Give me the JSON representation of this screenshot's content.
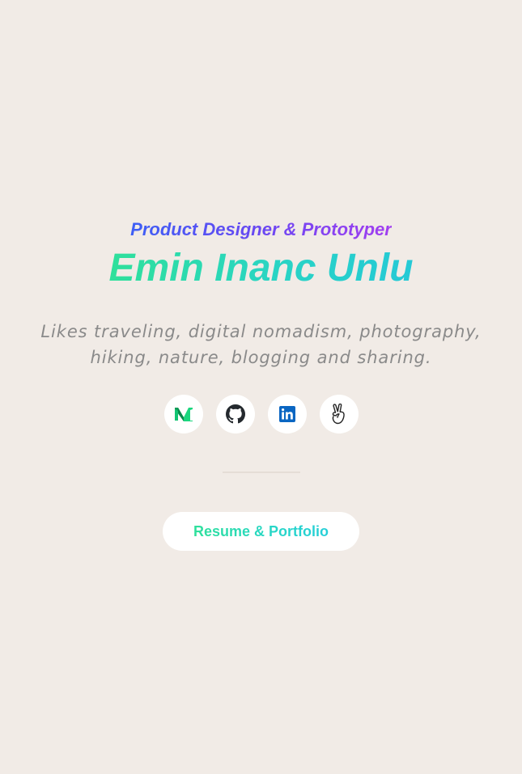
{
  "header": {
    "subtitle": "Product Designer & Prototyper",
    "name": "Emin Inanc Unlu",
    "bio": "Likes traveling, digital nomadism, photography, hiking, nature, blogging and sharing."
  },
  "socials": [
    {
      "icon": "medium-icon"
    },
    {
      "icon": "github-icon"
    },
    {
      "icon": "linkedin-icon"
    },
    {
      "icon": "angellist-icon"
    }
  ],
  "cta": {
    "label": "Resume & Portfolio"
  },
  "colors": {
    "background": "#f1ebe6",
    "subtitle_gradient": [
      "#3d5ff5",
      "#a23ef0"
    ],
    "name_gradient": [
      "#2fe09b",
      "#25c9d6"
    ],
    "bio_text": "#8a8a8a",
    "medium_green": "#12c472",
    "linkedin_blue": "#0a66c2"
  }
}
